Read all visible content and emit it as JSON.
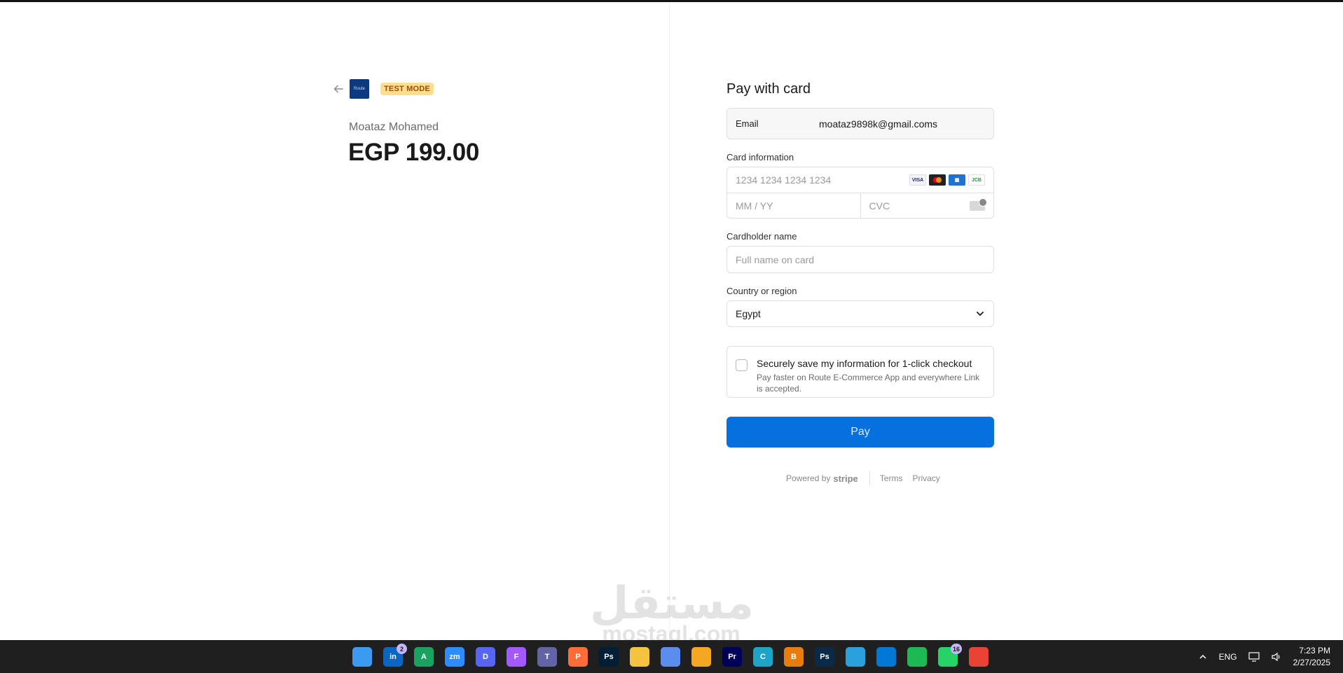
{
  "header": {
    "badge": "TEST MODE",
    "logo_text": "Route"
  },
  "summary": {
    "merchant_name": "Moataz Mohamed",
    "amount": "EGP 199.00"
  },
  "form": {
    "title": "Pay with card",
    "email_label": "Email",
    "email_value": "moataz9898k@gmail.coms",
    "card_info_label": "Card information",
    "card_number_placeholder": "1234 1234 1234 1234",
    "card_brands": [
      "VISA",
      "MC",
      "AMEX",
      "JCB"
    ],
    "expiry_placeholder": "MM / YY",
    "cvc_placeholder": "CVC",
    "cardholder_label": "Cardholder name",
    "cardholder_placeholder": "Full name on card",
    "country_label": "Country or region",
    "country_value": "Egypt",
    "save_title": "Securely save my information for 1-click checkout",
    "save_desc": "Pay faster on Route E-Commerce App and everywhere Link is accepted.",
    "pay_label": "Pay"
  },
  "footer": {
    "powered_by": "Powered by",
    "stripe": "stripe",
    "terms": "Terms",
    "privacy": "Privacy"
  },
  "watermark": {
    "arabic": "مستقل",
    "latin": "mostaql.com"
  },
  "taskbar": {
    "icons": [
      {
        "name": "start-icon",
        "label": "",
        "color": "#3a9bf0"
      },
      {
        "name": "linkedin-icon",
        "label": "in",
        "color": "#0a66c2",
        "badge": "2"
      },
      {
        "name": "sheets-icon",
        "label": "A",
        "color": "#1aa260"
      },
      {
        "name": "zoom-icon",
        "label": "zm",
        "color": "#2d8cff"
      },
      {
        "name": "discord-icon",
        "label": "D",
        "color": "#5865f2"
      },
      {
        "name": "figma-icon",
        "label": "F",
        "color": "#a259ff"
      },
      {
        "name": "teams-icon",
        "label": "T",
        "color": "#6264a7"
      },
      {
        "name": "postman-icon",
        "label": "P",
        "color": "#ff6c37"
      },
      {
        "name": "photoshop-icon",
        "label": "Ps",
        "color": "#001e36"
      },
      {
        "name": "file-explorer-icon",
        "label": "",
        "color": "#f5c242"
      },
      {
        "name": "paint-icon",
        "label": "",
        "color": "#5b8def"
      },
      {
        "name": "network-icon",
        "label": "",
        "color": "#f5a623"
      },
      {
        "name": "premiere-icon",
        "label": "Pr",
        "color": "#00005b"
      },
      {
        "name": "canva-icon",
        "label": "C",
        "color": "#1ea3c9"
      },
      {
        "name": "blender-icon",
        "label": "B",
        "color": "#e87d0d"
      },
      {
        "name": "photoshop-2-icon",
        "label": "Ps",
        "color": "#0a2a4a"
      },
      {
        "name": "telegram-icon",
        "label": "",
        "color": "#2aa1da"
      },
      {
        "name": "vscode-icon",
        "label": "",
        "color": "#0078d4"
      },
      {
        "name": "spotify-icon",
        "label": "",
        "color": "#1db954"
      },
      {
        "name": "whatsapp-icon",
        "label": "",
        "color": "#25d366",
        "badge": "16"
      },
      {
        "name": "chrome-icon",
        "label": "",
        "color": "#ea4335"
      }
    ],
    "language": "ENG",
    "time": "7:23 PM",
    "date": "2/27/2025"
  }
}
